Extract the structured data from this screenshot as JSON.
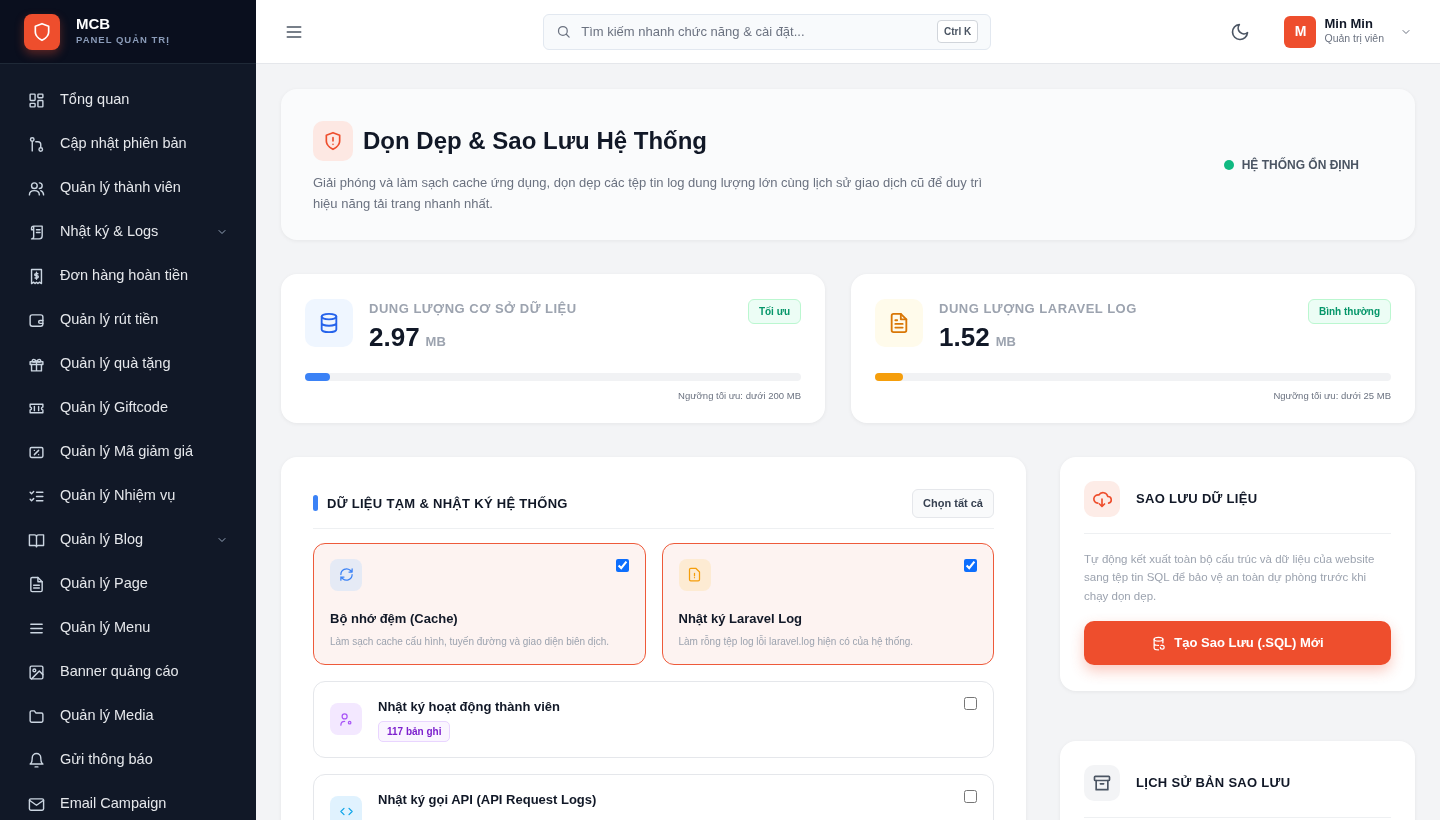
{
  "brand": {
    "name": "MCB",
    "subtitle": "PANEL QUẢN TRỊ"
  },
  "sidebar": {
    "items": [
      {
        "label": "Tổng quan",
        "kind": "link"
      },
      {
        "label": "Cập nhật phiên bản",
        "kind": "link"
      },
      {
        "label": "Quản lý thành viên",
        "kind": "link"
      },
      {
        "label": "Nhật ký & Logs",
        "kind": "group"
      },
      {
        "label": "Đơn hàng hoàn tiền",
        "kind": "link"
      },
      {
        "label": "Quản lý rút tiền",
        "kind": "link"
      },
      {
        "label": "Quản lý quà tặng",
        "kind": "link"
      },
      {
        "label": "Quản lý Giftcode",
        "kind": "link"
      },
      {
        "label": "Quản lý Mã giảm giá",
        "kind": "link"
      },
      {
        "label": "Quản lý Nhiệm vụ",
        "kind": "link"
      },
      {
        "label": "Quản lý Blog",
        "kind": "group"
      },
      {
        "label": "Quản lý Page",
        "kind": "link"
      },
      {
        "label": "Quản lý Menu",
        "kind": "link"
      },
      {
        "label": "Banner quảng cáo",
        "kind": "link"
      },
      {
        "label": "Quản lý Media",
        "kind": "link"
      },
      {
        "label": "Gửi thông báo",
        "kind": "link"
      },
      {
        "label": "Email Campaign",
        "kind": "link"
      }
    ]
  },
  "header": {
    "search": {
      "placeholder": "Tìm kiếm nhanh chức năng & cài đặt..."
    },
    "shortcut": "Ctrl K",
    "user": {
      "avatar": "M",
      "name": "Min Min",
      "role": "Quản trị viên"
    }
  },
  "hero": {
    "title": "Dọn Dẹp & Sao Lưu Hệ Thống",
    "description": "Giải phóng và làm sạch cache ứng dụng, dọn dẹp các tệp tin log dung lượng lớn cùng lịch sử giao dịch cũ để duy trì hiệu năng tải trang nhanh nhất.",
    "status": {
      "label": "HỆ THỐNG ỔN ĐỊNH",
      "color": "#10b981"
    }
  },
  "stats": [
    {
      "label": "DUNG LƯỢNG CƠ SỞ DỮ LIỆU",
      "value": "2.97",
      "unit": "MB",
      "badge": "Tối ưu",
      "level": 0.05,
      "color": "#3b82f6",
      "note": "Ngưỡng tối ưu: dưới 200 MB"
    },
    {
      "label": "DUNG LƯỢNG LARAVEL LOG",
      "value": "1.52",
      "unit": "MB",
      "badge": "Bình thường",
      "level": 0.055,
      "color": "#f59e0b",
      "note": "Ngưỡng tối ưu: dưới 25 MB"
    }
  ],
  "cleanup": {
    "title": "DỮ LIỆU TẠM & NHẬT KÝ HỆ THỐNG",
    "select_all": "Chọn tất cả",
    "items": [
      {
        "kind": "tile",
        "title": "Bộ nhớ đệm (Cache)",
        "description": "Làm sạch cache cấu hình, tuyến đường và giao diện biên dịch.",
        "checked": true
      },
      {
        "kind": "tile",
        "title": "Nhật ký Laravel Log",
        "description": "Làm rỗng tệp log lỗi laravel.log hiện có của hệ thống.",
        "checked": true
      },
      {
        "kind": "row",
        "title": "Nhật ký hoạt động thành viên",
        "badge": "117 bản ghi",
        "checked": false
      },
      {
        "kind": "row",
        "title": "Nhật ký gọi API (API Request Logs)",
        "checked": false
      }
    ]
  },
  "backup": {
    "title": "SAO LƯU DỮ LIỆU",
    "description": "Tự động kết xuất toàn bộ cấu trúc và dữ liệu của website sang tệp tin SQL để bảo vệ an toàn dự phòng trước khi chạy dọn dẹp.",
    "button": "Tạo Sao Lưu (.SQL) Mới"
  },
  "history": {
    "title": "LỊCH SỬ BẢN SAO LƯU"
  }
}
